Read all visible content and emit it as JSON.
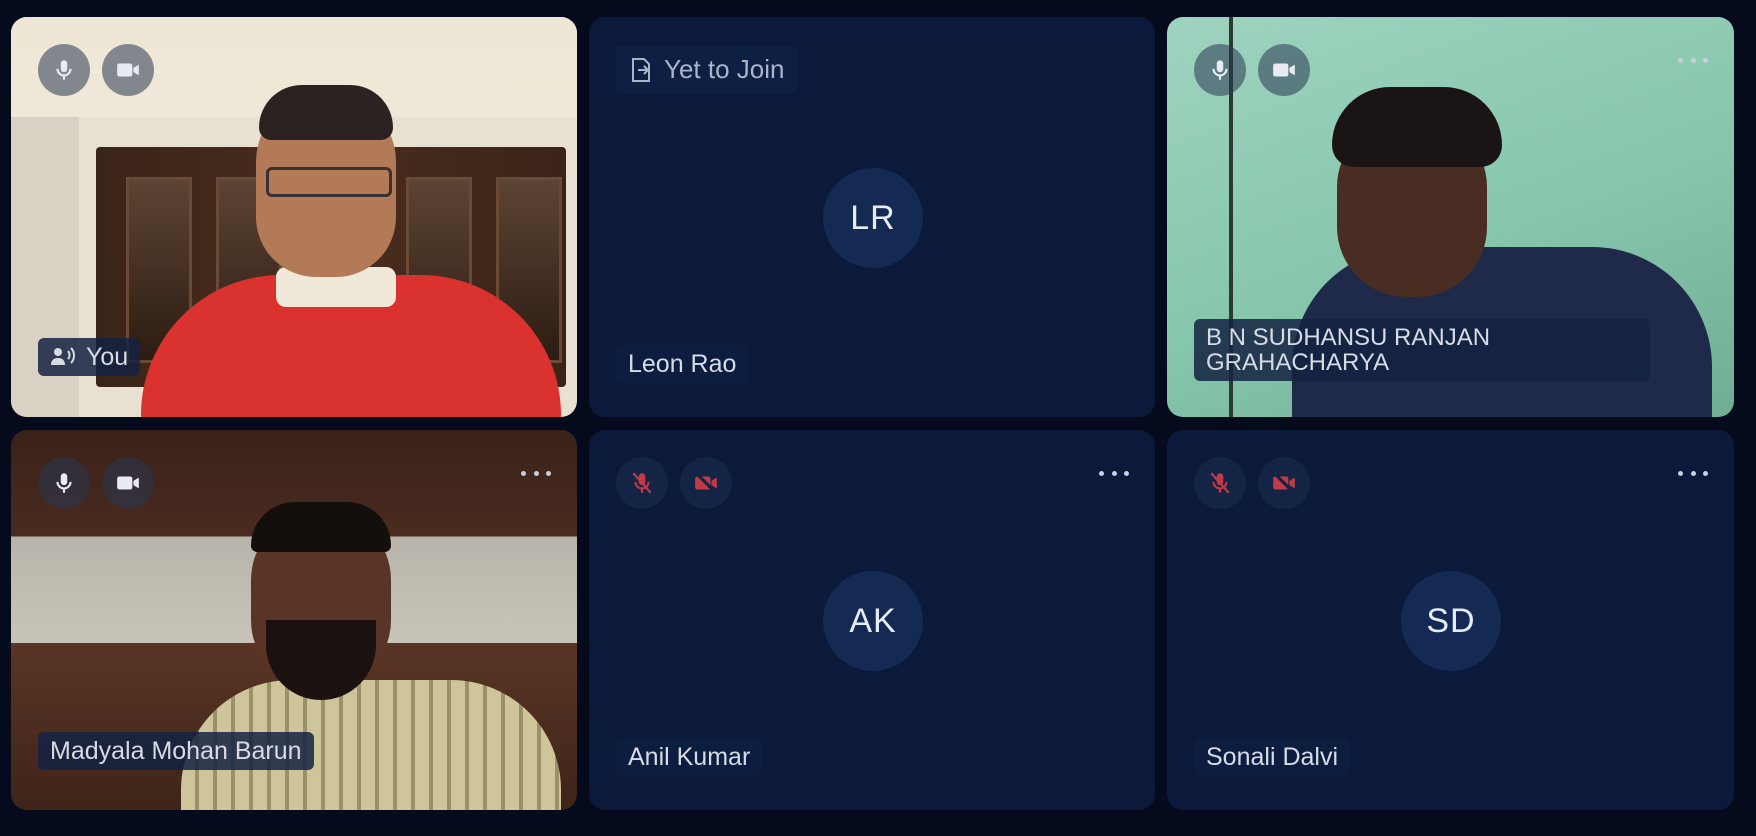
{
  "tiles": [
    {
      "name": "You",
      "speaking": true,
      "mic": "on",
      "camera": "on",
      "video": true
    },
    {
      "name": "Leon Rao",
      "initials": "LR",
      "status": "Yet to Join",
      "video": false
    },
    {
      "name": "B N SUDHANSU RANJAN GRAHACHARYA",
      "mic": "on",
      "camera": "on",
      "video": true
    },
    {
      "name": "Madyala Mohan Barun",
      "mic": "on",
      "camera": "on",
      "video": true
    },
    {
      "name": "Anil Kumar",
      "initials": "AK",
      "mic": "muted",
      "camera": "off",
      "video": false
    },
    {
      "name": "Sonali Dalvi",
      "initials": "SD",
      "mic": "muted",
      "camera": "off",
      "video": false
    }
  ],
  "colors": {
    "background": "#050a1c",
    "tile": "#0b1a3b",
    "muted_icon": "#c23a4a",
    "label_text": "#d7dbe6"
  },
  "icons": {
    "mic": "microphone-icon",
    "camera": "video-camera-icon",
    "mic_muted": "microphone-off-icon",
    "camera_off": "video-camera-off-icon",
    "more": "more-options-icon",
    "speaking": "speaking-icon",
    "join": "exit-door-icon"
  }
}
